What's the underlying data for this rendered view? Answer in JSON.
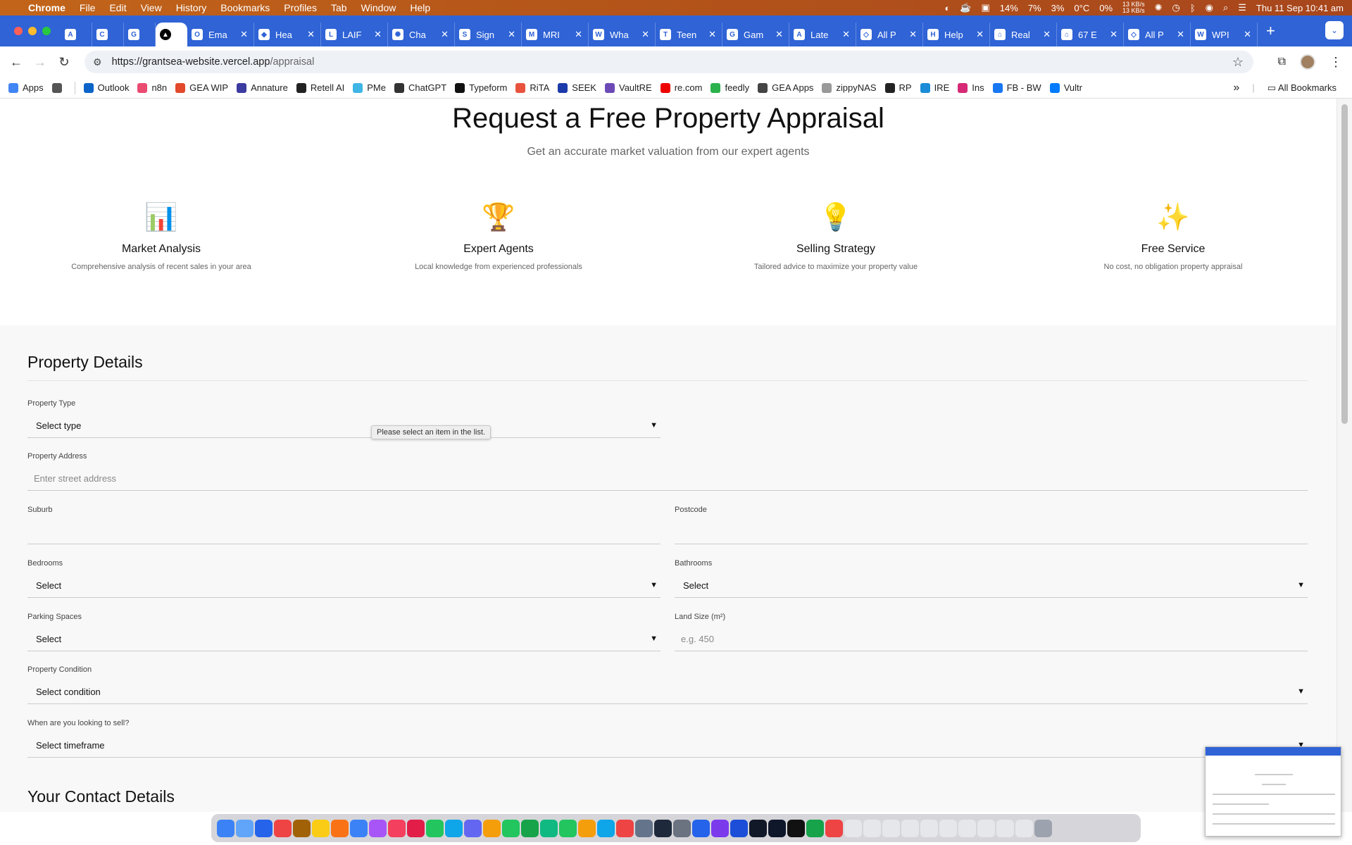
{
  "menubar": {
    "apple": "",
    "app": "Chrome",
    "items": [
      "File",
      "Edit",
      "View",
      "History",
      "Bookmarks",
      "Profiles",
      "Tab",
      "Window",
      "Help"
    ],
    "status": {
      "cpu": "14%",
      "mem": "7%",
      "disk": "3%",
      "temp": "0°C",
      "gpu": "0%",
      "net_up": "13 KB/s",
      "net_down": "13 KB/s",
      "datetime": "Thu 11 Sep  10:41 am"
    }
  },
  "tabs": [
    {
      "label": "",
      "icon": "A"
    },
    {
      "label": "",
      "icon": "C"
    },
    {
      "label": "",
      "icon": "G"
    },
    {
      "label": "",
      "icon": "▲",
      "active": true
    },
    {
      "label": "Ema",
      "icon": "O"
    },
    {
      "label": "Hea",
      "icon": "◆"
    },
    {
      "label": "LAIF",
      "icon": "L"
    },
    {
      "label": "Cha",
      "icon": "✺"
    },
    {
      "label": "Sign",
      "icon": "S"
    },
    {
      "label": "MRI",
      "icon": "M"
    },
    {
      "label": "Wha",
      "icon": "W"
    },
    {
      "label": "Teen",
      "icon": "T"
    },
    {
      "label": "Gam",
      "icon": "G"
    },
    {
      "label": "Late",
      "icon": "A"
    },
    {
      "label": "All P",
      "icon": "◇"
    },
    {
      "label": "Help",
      "icon": "H"
    },
    {
      "label": "Real",
      "icon": "⌂"
    },
    {
      "label": "67 E",
      "icon": "⌂"
    },
    {
      "label": "All P",
      "icon": "◇"
    },
    {
      "label": "WPI",
      "icon": "W"
    }
  ],
  "toolbar": {
    "url_host": "https://grantsea-website.vercel.app",
    "url_path": "/appraisal"
  },
  "bookmarks": [
    {
      "label": "Apps",
      "color": "#4285f4"
    },
    {
      "label": "",
      "color": "#555"
    },
    {
      "label": "Outlook",
      "color": "#0a64c8"
    },
    {
      "label": "n8n",
      "color": "#ea4b71"
    },
    {
      "label": "GEA WIP",
      "color": "#e24a2b"
    },
    {
      "label": "Annature",
      "color": "#3b3ba0"
    },
    {
      "label": "Retell AI",
      "color": "#222"
    },
    {
      "label": "PMe",
      "color": "#3fb5e5"
    },
    {
      "label": "ChatGPT",
      "color": "#333"
    },
    {
      "label": "Typeform",
      "color": "#111"
    },
    {
      "label": "RiTA",
      "color": "#e9533e"
    },
    {
      "label": "SEEK",
      "color": "#1c3aa9"
    },
    {
      "label": "VaultRE",
      "color": "#6c4ab6"
    },
    {
      "label": "re.com",
      "color": "#e00"
    },
    {
      "label": "feedly",
      "color": "#2bb24c"
    },
    {
      "label": "GEA Apps",
      "color": "#444"
    },
    {
      "label": "zippyNAS",
      "color": "#999"
    },
    {
      "label": "RP",
      "color": "#222"
    },
    {
      "label": "IRE",
      "color": "#1a8cd8"
    },
    {
      "label": "Ins",
      "color": "#d62976"
    },
    {
      "label": "FB - BW",
      "color": "#1877f2"
    },
    {
      "label": "Vultr",
      "color": "#007bfc"
    }
  ],
  "bookmarks_more": "»",
  "all_bookmarks": "All Bookmarks",
  "hero": {
    "title": "Request a Free Property Appraisal",
    "subtitle": "Get an accurate market valuation from our expert agents"
  },
  "features": [
    {
      "emoji": "📊",
      "title": "Market Analysis",
      "desc": "Comprehensive analysis of recent sales in your area"
    },
    {
      "emoji": "🏆",
      "title": "Expert Agents",
      "desc": "Local knowledge from experienced professionals"
    },
    {
      "emoji": "💡",
      "title": "Selling Strategy",
      "desc": "Tailored advice to maximize your property value"
    },
    {
      "emoji": "✨",
      "title": "Free Service",
      "desc": "No cost, no obligation property appraisal"
    }
  ],
  "form": {
    "section_title": "Property Details",
    "property_type": {
      "label": "Property Type",
      "value": "Select type"
    },
    "tooltip": "Please select an item in the list.",
    "address": {
      "label": "Property Address",
      "placeholder": "Enter street address"
    },
    "suburb": {
      "label": "Suburb",
      "value": ""
    },
    "postcode": {
      "label": "Postcode",
      "value": ""
    },
    "bedrooms": {
      "label": "Bedrooms",
      "value": "Select"
    },
    "bathrooms": {
      "label": "Bathrooms",
      "value": "Select"
    },
    "parking": {
      "label": "Parking Spaces",
      "value": "Select"
    },
    "land": {
      "label": "Land Size (m²)",
      "placeholder": "e.g. 450"
    },
    "condition": {
      "label": "Property Condition",
      "value": "Select condition"
    },
    "timeframe": {
      "label": "When are you looking to sell?",
      "value": "Select timeframe"
    },
    "contact_title": "Your Contact Details"
  },
  "icons": {
    "chevron": "chevron-down-icon"
  }
}
